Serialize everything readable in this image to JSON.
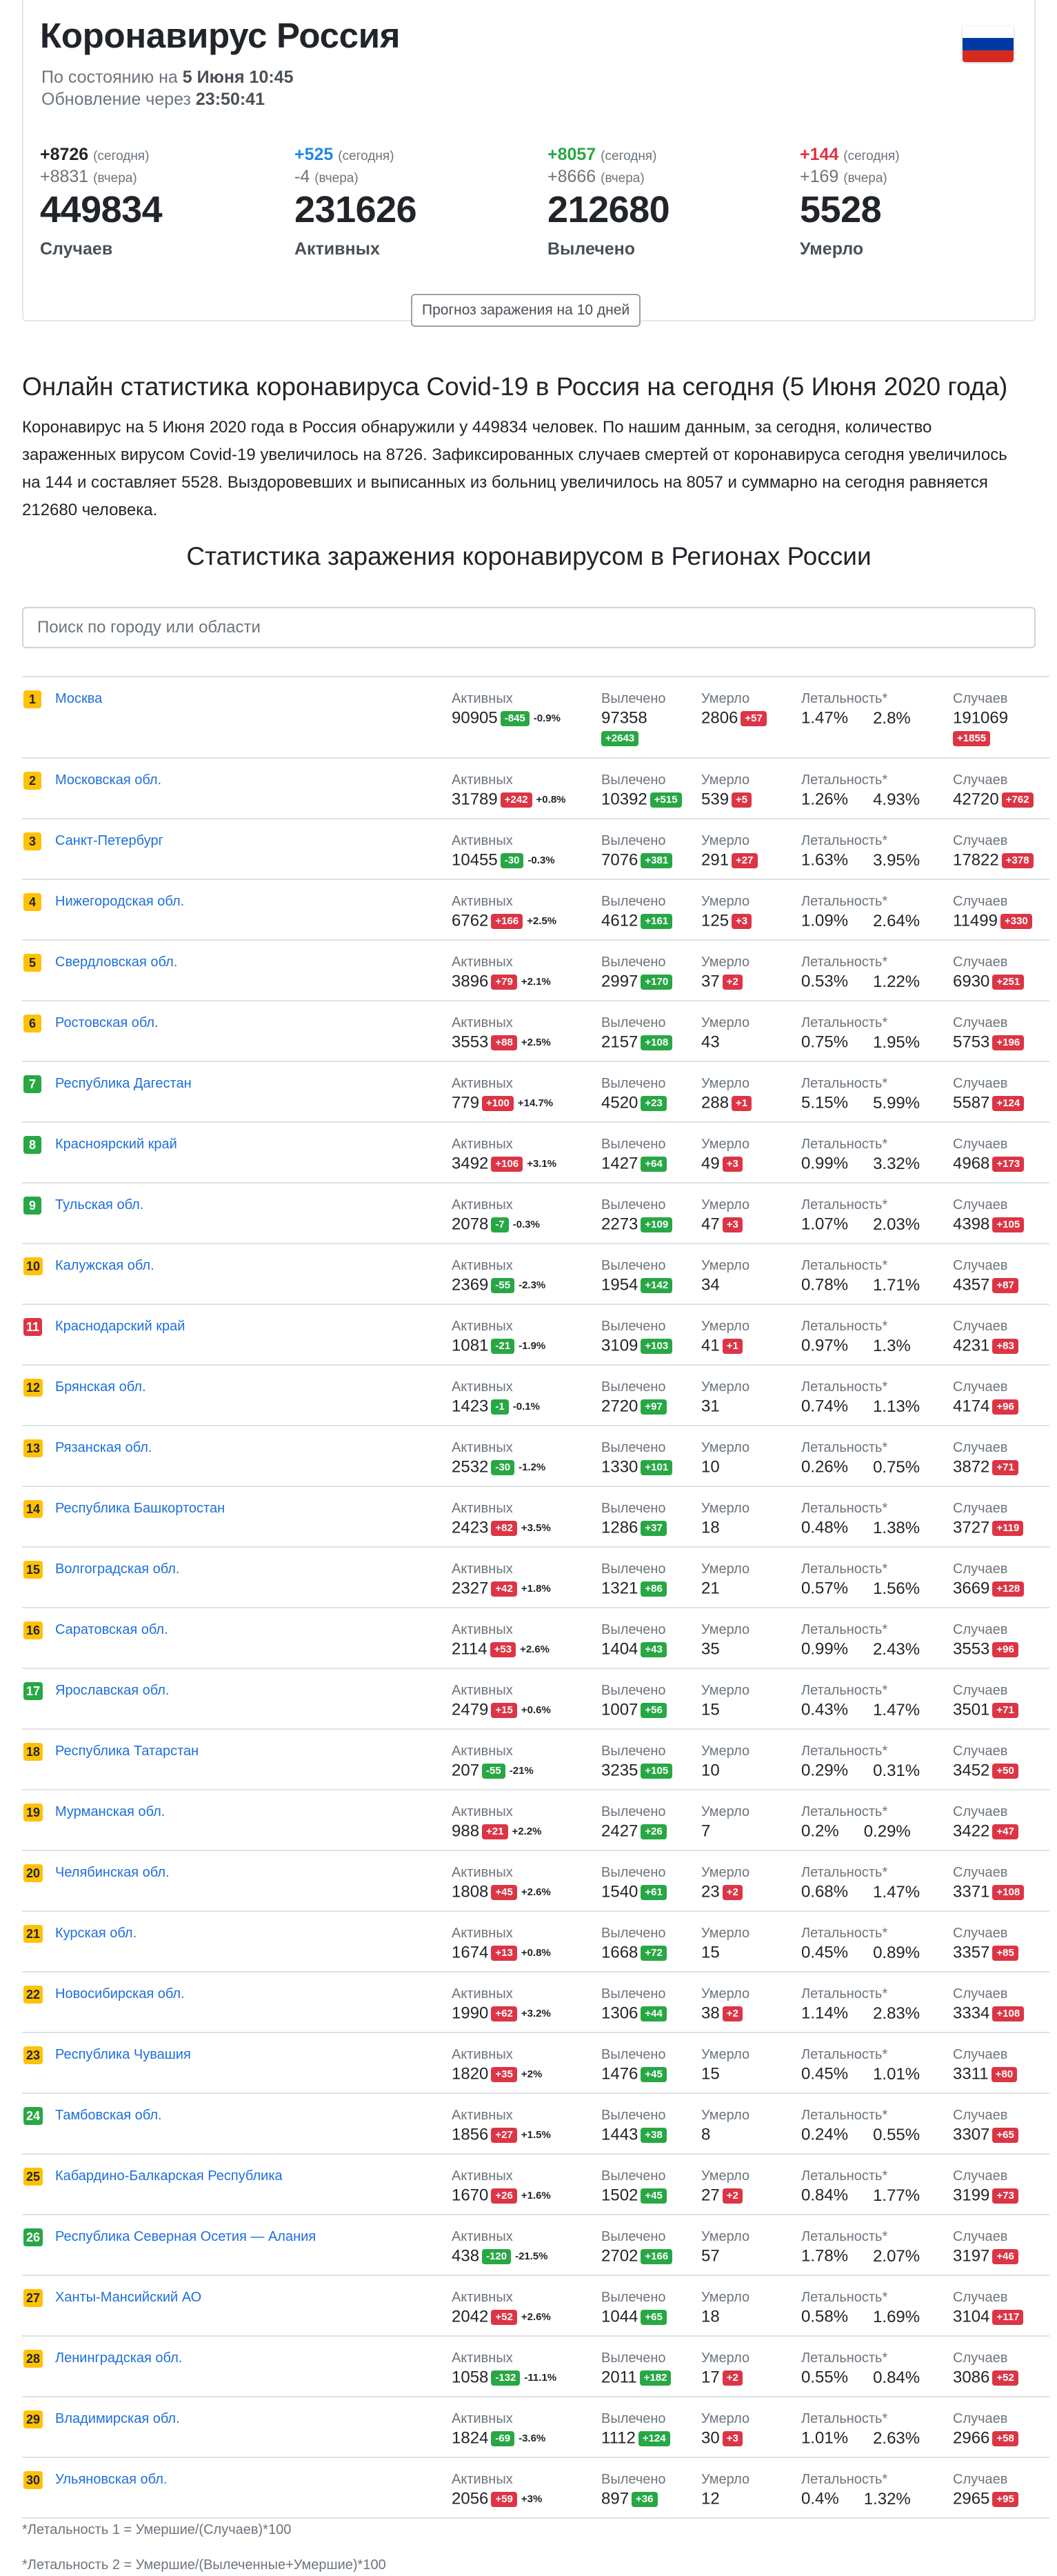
{
  "header": {
    "title": "Коронавирус Россия",
    "as_of_prefix": "По состоянию на",
    "as_of_value": "5 Июня 10:45",
    "update_prefix": "Обновление через",
    "update_value": "23:50:41",
    "flag_colors": [
      "#ffffff",
      "#0039a6",
      "#d52b1e"
    ]
  },
  "stats": [
    {
      "today": "+8726",
      "today_label": "(сегодня)",
      "yest": "+8831",
      "yest_label": "(вчера)",
      "total": "449834",
      "name": "Случаев",
      "color": "#212529"
    },
    {
      "today": "+525",
      "today_label": "(сегодня)",
      "yest": "-4",
      "yest_label": "(вчера)",
      "total": "231626",
      "name": "Активных",
      "color": "#1e88e5"
    },
    {
      "today": "+8057",
      "today_label": "(сегодня)",
      "yest": "+8666",
      "yest_label": "(вчера)",
      "total": "212680",
      "name": "Вылечено",
      "color": "#28a745"
    },
    {
      "today": "+144",
      "today_label": "(сегодня)",
      "yest": "+169",
      "yest_label": "(вчера)",
      "total": "5528",
      "name": "Умерло",
      "color": "#dc3545"
    }
  ],
  "forecast_button": "Прогноз заражения на 10 дней",
  "intro": {
    "heading": "Онлайн статистика коронавируса Covid-19 в Россия на сегодня (5 Июня 2020 года)",
    "text": "Коронавирус на 5 Июня 2020 года в Россия обнаружили у 449834 человек. По нашим данным, за сегодня, количество зараженных вирусом Covid-19 увеличилось на 8726. Зафиксированных случаев смертей от коронавируса сегодня увеличилось на 144 и составляет 5528. Выздоровевших и выписанных из больниц увеличилось на 8057 и суммарно на сегодня равняется 212680 человека."
  },
  "regions_heading": "Статистика заражения коронавирусом в Регионах России",
  "search_placeholder": "Поиск по городу или области",
  "labels": {
    "active": "Активных",
    "recovered": "Вылечено",
    "deaths": "Умерло",
    "lethality": "Летальность*",
    "cases": "Случаев"
  },
  "regions": [
    {
      "rank": "1",
      "rank_color": "yellow",
      "name": "Москва",
      "active": "90905",
      "active_d": "-845",
      "active_p": "-0.9%",
      "recovered": "97358",
      "recovered_d": "+2643",
      "deaths": "2806",
      "deaths_d": "+57",
      "l1": "1.47%",
      "l2": "2.8%",
      "cases": "191069",
      "cases_d": "+1855"
    },
    {
      "rank": "2",
      "rank_color": "yellow",
      "name": "Московская обл.",
      "active": "31789",
      "active_d": "+242",
      "active_p": "+0.8%",
      "recovered": "10392",
      "recovered_d": "+515",
      "deaths": "539",
      "deaths_d": "+5",
      "l1": "1.26%",
      "l2": "4.93%",
      "cases": "42720",
      "cases_d": "+762"
    },
    {
      "rank": "3",
      "rank_color": "yellow",
      "name": "Санкт-Петербург",
      "active": "10455",
      "active_d": "-30",
      "active_p": "-0.3%",
      "recovered": "7076",
      "recovered_d": "+381",
      "deaths": "291",
      "deaths_d": "+27",
      "l1": "1.63%",
      "l2": "3.95%",
      "cases": "17822",
      "cases_d": "+378"
    },
    {
      "rank": "4",
      "rank_color": "yellow",
      "name": "Нижегородская обл.",
      "active": "6762",
      "active_d": "+166",
      "active_p": "+2.5%",
      "recovered": "4612",
      "recovered_d": "+161",
      "deaths": "125",
      "deaths_d": "+3",
      "l1": "1.09%",
      "l2": "2.64%",
      "cases": "11499",
      "cases_d": "+330"
    },
    {
      "rank": "5",
      "rank_color": "yellow",
      "name": "Свердловская обл.",
      "active": "3896",
      "active_d": "+79",
      "active_p": "+2.1%",
      "recovered": "2997",
      "recovered_d": "+170",
      "deaths": "37",
      "deaths_d": "+2",
      "l1": "0.53%",
      "l2": "1.22%",
      "cases": "6930",
      "cases_d": "+251"
    },
    {
      "rank": "6",
      "rank_color": "yellow",
      "name": "Ростовская обл.",
      "active": "3553",
      "active_d": "+88",
      "active_p": "+2.5%",
      "recovered": "2157",
      "recovered_d": "+108",
      "deaths": "43",
      "deaths_d": "",
      "l1": "0.75%",
      "l2": "1.95%",
      "cases": "5753",
      "cases_d": "+196"
    },
    {
      "rank": "7",
      "rank_color": "green",
      "name": "Республика Дагестан",
      "active": "779",
      "active_d": "+100",
      "active_p": "+14.7%",
      "recovered": "4520",
      "recovered_d": "+23",
      "deaths": "288",
      "deaths_d": "+1",
      "l1": "5.15%",
      "l2": "5.99%",
      "cases": "5587",
      "cases_d": "+124"
    },
    {
      "rank": "8",
      "rank_color": "green",
      "name": "Красноярский край",
      "active": "3492",
      "active_d": "+106",
      "active_p": "+3.1%",
      "recovered": "1427",
      "recovered_d": "+64",
      "deaths": "49",
      "deaths_d": "+3",
      "l1": "0.99%",
      "l2": "3.32%",
      "cases": "4968",
      "cases_d": "+173"
    },
    {
      "rank": "9",
      "rank_color": "green",
      "name": "Тульская обл.",
      "active": "2078",
      "active_d": "-7",
      "active_p": "-0.3%",
      "recovered": "2273",
      "recovered_d": "+109",
      "deaths": "47",
      "deaths_d": "+3",
      "l1": "1.07%",
      "l2": "2.03%",
      "cases": "4398",
      "cases_d": "+105"
    },
    {
      "rank": "10",
      "rank_color": "yellow",
      "name": "Калужская обл.",
      "active": "2369",
      "active_d": "-55",
      "active_p": "-2.3%",
      "recovered": "1954",
      "recovered_d": "+142",
      "deaths": "34",
      "deaths_d": "",
      "l1": "0.78%",
      "l2": "1.71%",
      "cases": "4357",
      "cases_d": "+87"
    },
    {
      "rank": "11",
      "rank_color": "red",
      "name": "Краснодарский край",
      "active": "1081",
      "active_d": "-21",
      "active_p": "-1.9%",
      "recovered": "3109",
      "recovered_d": "+103",
      "deaths": "41",
      "deaths_d": "+1",
      "l1": "0.97%",
      "l2": "1.3%",
      "cases": "4231",
      "cases_d": "+83"
    },
    {
      "rank": "12",
      "rank_color": "yellow",
      "name": "Брянская обл.",
      "active": "1423",
      "active_d": "-1",
      "active_p": "-0.1%",
      "recovered": "2720",
      "recovered_d": "+97",
      "deaths": "31",
      "deaths_d": "",
      "l1": "0.74%",
      "l2": "1.13%",
      "cases": "4174",
      "cases_d": "+96"
    },
    {
      "rank": "13",
      "rank_color": "yellow",
      "name": "Рязанская обл.",
      "active": "2532",
      "active_d": "-30",
      "active_p": "-1.2%",
      "recovered": "1330",
      "recovered_d": "+101",
      "deaths": "10",
      "deaths_d": "",
      "l1": "0.26%",
      "l2": "0.75%",
      "cases": "3872",
      "cases_d": "+71"
    },
    {
      "rank": "14",
      "rank_color": "yellow",
      "name": "Республика Башкортостан",
      "active": "2423",
      "active_d": "+82",
      "active_p": "+3.5%",
      "recovered": "1286",
      "recovered_d": "+37",
      "deaths": "18",
      "deaths_d": "",
      "l1": "0.48%",
      "l2": "1.38%",
      "cases": "3727",
      "cases_d": "+119"
    },
    {
      "rank": "15",
      "rank_color": "yellow",
      "name": "Волгоградская обл.",
      "active": "2327",
      "active_d": "+42",
      "active_p": "+1.8%",
      "recovered": "1321",
      "recovered_d": "+86",
      "deaths": "21",
      "deaths_d": "",
      "l1": "0.57%",
      "l2": "1.56%",
      "cases": "3669",
      "cases_d": "+128"
    },
    {
      "rank": "16",
      "rank_color": "yellow",
      "name": "Саратовская обл.",
      "active": "2114",
      "active_d": "+53",
      "active_p": "+2.6%",
      "recovered": "1404",
      "recovered_d": "+43",
      "deaths": "35",
      "deaths_d": "",
      "l1": "0.99%",
      "l2": "2.43%",
      "cases": "3553",
      "cases_d": "+96"
    },
    {
      "rank": "17",
      "rank_color": "green",
      "name": "Ярославская обл.",
      "active": "2479",
      "active_d": "+15",
      "active_p": "+0.6%",
      "recovered": "1007",
      "recovered_d": "+56",
      "deaths": "15",
      "deaths_d": "",
      "l1": "0.43%",
      "l2": "1.47%",
      "cases": "3501",
      "cases_d": "+71"
    },
    {
      "rank": "18",
      "rank_color": "yellow",
      "name": "Республика Татарстан",
      "active": "207",
      "active_d": "-55",
      "active_p": "-21%",
      "recovered": "3235",
      "recovered_d": "+105",
      "deaths": "10",
      "deaths_d": "",
      "l1": "0.29%",
      "l2": "0.31%",
      "cases": "3452",
      "cases_d": "+50"
    },
    {
      "rank": "19",
      "rank_color": "yellow",
      "name": "Мурманская обл.",
      "active": "988",
      "active_d": "+21",
      "active_p": "+2.2%",
      "recovered": "2427",
      "recovered_d": "+26",
      "deaths": "7",
      "deaths_d": "",
      "l1": "0.2%",
      "l2": "0.29%",
      "cases": "3422",
      "cases_d": "+47"
    },
    {
      "rank": "20",
      "rank_color": "yellow",
      "name": "Челябинская обл.",
      "active": "1808",
      "active_d": "+45",
      "active_p": "+2.6%",
      "recovered": "1540",
      "recovered_d": "+61",
      "deaths": "23",
      "deaths_d": "+2",
      "l1": "0.68%",
      "l2": "1.47%",
      "cases": "3371",
      "cases_d": "+108"
    },
    {
      "rank": "21",
      "rank_color": "yellow",
      "name": "Курская обл.",
      "active": "1674",
      "active_d": "+13",
      "active_p": "+0.8%",
      "recovered": "1668",
      "recovered_d": "+72",
      "deaths": "15",
      "deaths_d": "",
      "l1": "0.45%",
      "l2": "0.89%",
      "cases": "3357",
      "cases_d": "+85"
    },
    {
      "rank": "22",
      "rank_color": "yellow",
      "name": "Новосибирская обл.",
      "active": "1990",
      "active_d": "+62",
      "active_p": "+3.2%",
      "recovered": "1306",
      "recovered_d": "+44",
      "deaths": "38",
      "deaths_d": "+2",
      "l1": "1.14%",
      "l2": "2.83%",
      "cases": "3334",
      "cases_d": "+108"
    },
    {
      "rank": "23",
      "rank_color": "yellow",
      "name": "Республика Чувашия",
      "active": "1820",
      "active_d": "+35",
      "active_p": "+2%",
      "recovered": "1476",
      "recovered_d": "+45",
      "deaths": "15",
      "deaths_d": "",
      "l1": "0.45%",
      "l2": "1.01%",
      "cases": "3311",
      "cases_d": "+80"
    },
    {
      "rank": "24",
      "rank_color": "green",
      "name": "Тамбовская обл.",
      "active": "1856",
      "active_d": "+27",
      "active_p": "+1.5%",
      "recovered": "1443",
      "recovered_d": "+38",
      "deaths": "8",
      "deaths_d": "",
      "l1": "0.24%",
      "l2": "0.55%",
      "cases": "3307",
      "cases_d": "+65"
    },
    {
      "rank": "25",
      "rank_color": "yellow",
      "name": "Кабардино-Балкарская Республика",
      "active": "1670",
      "active_d": "+26",
      "active_p": "+1.6%",
      "recovered": "1502",
      "recovered_d": "+45",
      "deaths": "27",
      "deaths_d": "+2",
      "l1": "0.84%",
      "l2": "1.77%",
      "cases": "3199",
      "cases_d": "+73"
    },
    {
      "rank": "26",
      "rank_color": "green",
      "name": "Республика Северная Осетия — Алания",
      "active": "438",
      "active_d": "-120",
      "active_p": "-21.5%",
      "recovered": "2702",
      "recovered_d": "+166",
      "deaths": "57",
      "deaths_d": "",
      "l1": "1.78%",
      "l2": "2.07%",
      "cases": "3197",
      "cases_d": "+46"
    },
    {
      "rank": "27",
      "rank_color": "yellow",
      "name": "Ханты-Мансийский АО",
      "active": "2042",
      "active_d": "+52",
      "active_p": "+2.6%",
      "recovered": "1044",
      "recovered_d": "+65",
      "deaths": "18",
      "deaths_d": "",
      "l1": "0.58%",
      "l2": "1.69%",
      "cases": "3104",
      "cases_d": "+117"
    },
    {
      "rank": "28",
      "rank_color": "yellow",
      "name": "Ленинградская обл.",
      "active": "1058",
      "active_d": "-132",
      "active_p": "-11.1%",
      "recovered": "2011",
      "recovered_d": "+182",
      "deaths": "17",
      "deaths_d": "+2",
      "l1": "0.55%",
      "l2": "0.84%",
      "cases": "3086",
      "cases_d": "+52"
    },
    {
      "rank": "29",
      "rank_color": "yellow",
      "name": "Владимирская обл.",
      "active": "1824",
      "active_d": "-69",
      "active_p": "-3.6%",
      "recovered": "1112",
      "recovered_d": "+124",
      "deaths": "30",
      "deaths_d": "+3",
      "l1": "1.01%",
      "l2": "2.63%",
      "cases": "2966",
      "cases_d": "+58"
    },
    {
      "rank": "30",
      "rank_color": "yellow",
      "name": "Ульяновская обл.",
      "active": "2056",
      "active_d": "+59",
      "active_p": "+3%",
      "recovered": "897",
      "recovered_d": "+36",
      "deaths": "12",
      "deaths_d": "",
      "l1": "0.4%",
      "l2": "1.32%",
      "cases": "2965",
      "cases_d": "+95"
    }
  ],
  "footnotes": [
    "*Летальность 1 = Умершие/(Случаев)*100",
    "*Летальность 2 = Умершие/(Вылеченные+Умершие)*100"
  ]
}
